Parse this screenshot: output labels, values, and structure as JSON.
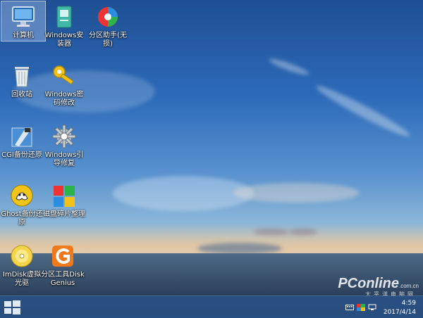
{
  "desktop": {
    "icons": [
      {
        "label": "计算机"
      },
      {
        "label": "Windows安装器"
      },
      {
        "label": "分区助手(无损)"
      },
      {
        "label": "回收站"
      },
      {
        "label": "Windows密码修改"
      },
      {
        "label": "CGI备份还原"
      },
      {
        "label": "Windows引导修复"
      },
      {
        "label": "Ghost备份还原"
      },
      {
        "label": "磁盘碎片整理"
      },
      {
        "label": "ImDisk虚拟光驱"
      },
      {
        "label": "分区工具DiskGenius"
      }
    ]
  },
  "taskbar": {
    "time": "4:59",
    "date": "2017/4/14"
  },
  "watermark": {
    "brand": "PConline",
    "domain": ".com.cn",
    "sub": "太平洋电脑网"
  }
}
